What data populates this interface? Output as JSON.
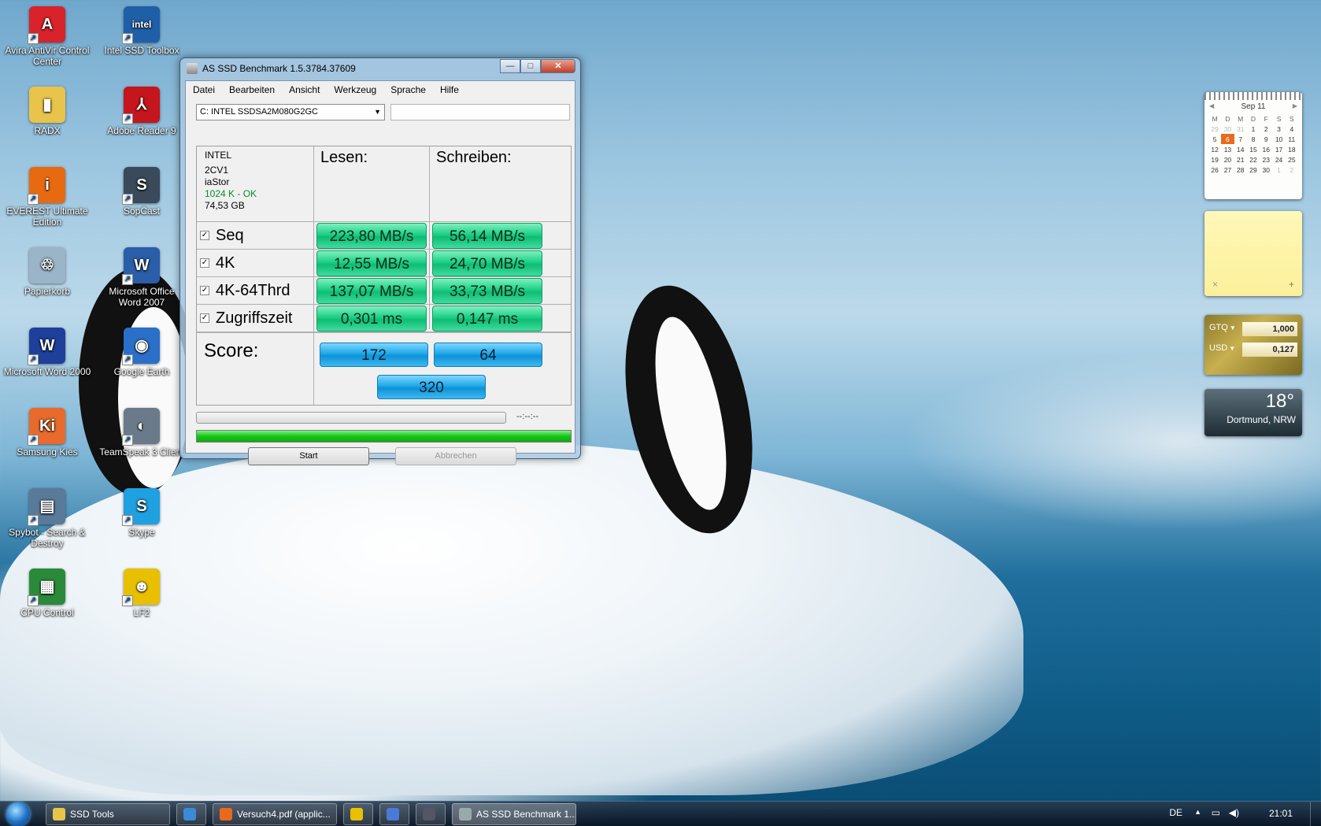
{
  "desktop": {
    "icons": [
      {
        "label": "Avira AntiVir Control Center",
        "icon": "avira-icon",
        "color": "#d8232a",
        "glyph": "A"
      },
      {
        "label": "Intel SSD Toolbox",
        "icon": "intel-icon",
        "color": "#1f5fa8",
        "glyph": "intel"
      },
      {
        "label": "RADX",
        "icon": "folder-icon",
        "color": "#e8c44a",
        "glyph": "▮"
      },
      {
        "label": "Adobe Reader 9",
        "icon": "adobe-reader-icon",
        "color": "#c4161c",
        "glyph": "⅄"
      },
      {
        "label": "EVEREST Ultimate Edition",
        "icon": "everest-icon",
        "color": "#e86a10",
        "glyph": "i"
      },
      {
        "label": "SopCast",
        "icon": "sopcast-icon",
        "color": "#3a4a5a",
        "glyph": "S"
      },
      {
        "label": "Papierkorb",
        "icon": "recycle-bin-icon",
        "color": "#9ab4c8",
        "glyph": "♲"
      },
      {
        "label": "Microsoft Office Word 2007",
        "icon": "word-2007-icon",
        "color": "#2b5ea8",
        "glyph": "W"
      },
      {
        "label": "Microsoft Word 2000",
        "icon": "word-2000-icon",
        "color": "#1e3f9a",
        "glyph": "W"
      },
      {
        "label": "Google Earth",
        "icon": "google-earth-icon",
        "color": "#2a70c8",
        "glyph": "◉"
      },
      {
        "label": "Samsung Kies",
        "icon": "samsung-kies-icon",
        "color": "#e86a2c",
        "glyph": "Ki"
      },
      {
        "label": "TeamSpeak 3 Client",
        "icon": "teamspeak-icon",
        "color": "#6a7a8a",
        "glyph": "◐"
      },
      {
        "label": "Spybot - Search & Destroy",
        "icon": "spybot-icon",
        "color": "#5a7a9a",
        "glyph": "▤"
      },
      {
        "label": "Skype",
        "icon": "skype-icon",
        "color": "#1fa0e0",
        "glyph": "S"
      },
      {
        "label": "CPU Control",
        "icon": "cpu-control-icon",
        "color": "#2a8a3a",
        "glyph": "▦"
      },
      {
        "label": "LF2",
        "icon": "lf2-icon",
        "color": "#e8c000",
        "glyph": "☻"
      }
    ]
  },
  "window": {
    "title": "AS SSD Benchmark 1.5.3784.37609",
    "controls": {
      "minimize": "—",
      "maximize": "□",
      "close": "✕"
    },
    "menu": [
      "Datei",
      "Bearbeiten",
      "Ansicht",
      "Werkzeug",
      "Sprache",
      "Hilfe"
    ],
    "drive_select": "C: INTEL SSDSA2M080G2GC",
    "drive_info": {
      "vendor": "INTEL",
      "firmware": "2CV1",
      "driver": "iaStor",
      "alignment": "1024 K - OK",
      "size": "74,53 GB"
    },
    "col_read": "Lesen:",
    "col_write": "Schreiben:",
    "rows": [
      {
        "label": "Seq",
        "checked": "✓",
        "read": "223,80 MB/s",
        "write": "56,14 MB/s"
      },
      {
        "label": "4K",
        "checked": "✓",
        "read": "12,55 MB/s",
        "write": "24,70 MB/s"
      },
      {
        "label": "4K-64Thrd",
        "checked": "✓",
        "read": "137,07 MB/s",
        "write": "33,73 MB/s"
      },
      {
        "label": "Zugriffszeit",
        "checked": "✓",
        "read": "0,301 ms",
        "write": "0,147 ms"
      }
    ],
    "score_label": "Score:",
    "score_read": "172",
    "score_write": "64",
    "score_total": "320",
    "timer": "--:--:--",
    "progress_fraction": 1.0,
    "start_label": "Start",
    "cancel_label": "Abbrechen"
  },
  "gadgets": {
    "calendar": {
      "month": "Sep 11",
      "prev": "◀",
      "next": "▶",
      "weekdays": [
        "M",
        "D",
        "M",
        "D",
        "F",
        "S",
        "S"
      ],
      "weeks": [
        [
          "29",
          "30",
          "31",
          "1",
          "2",
          "3",
          "4"
        ],
        [
          "5",
          "6",
          "7",
          "8",
          "9",
          "10",
          "11"
        ],
        [
          "12",
          "13",
          "14",
          "15",
          "16",
          "17",
          "18"
        ],
        [
          "19",
          "20",
          "21",
          "22",
          "23",
          "24",
          "25"
        ],
        [
          "26",
          "27",
          "28",
          "29",
          "30",
          "1",
          "2"
        ]
      ],
      "today": "6"
    },
    "note": {
      "close": "×",
      "add": "+"
    },
    "currency": {
      "from_code": "GTQ",
      "from_value": "1,000",
      "to_code": "USD",
      "to_value": "0,127"
    },
    "weather": {
      "temp": "18°",
      "location": "Dortmund, NRW"
    }
  },
  "taskbar": {
    "items": [
      {
        "label": "SSD Tools",
        "icon": "folder-icon",
        "color": "#e8c44a"
      },
      {
        "label": "",
        "icon": "internet-explorer-icon",
        "color": "#3a8ad8"
      },
      {
        "label": "Versuch4.pdf (applic...",
        "icon": "firefox-icon",
        "color": "#e86a1c"
      },
      {
        "label": "",
        "icon": "lightning-icon",
        "color": "#e8c000"
      },
      {
        "label": "",
        "icon": "bird-icon",
        "color": "#4a7ad8"
      },
      {
        "label": "",
        "icon": "steam-icon",
        "color": "#556"
      },
      {
        "label": "AS SSD Benchmark 1...",
        "icon": "as-ssd-icon",
        "color": "#9aa"
      }
    ],
    "language": "DE",
    "time": "21:01"
  }
}
